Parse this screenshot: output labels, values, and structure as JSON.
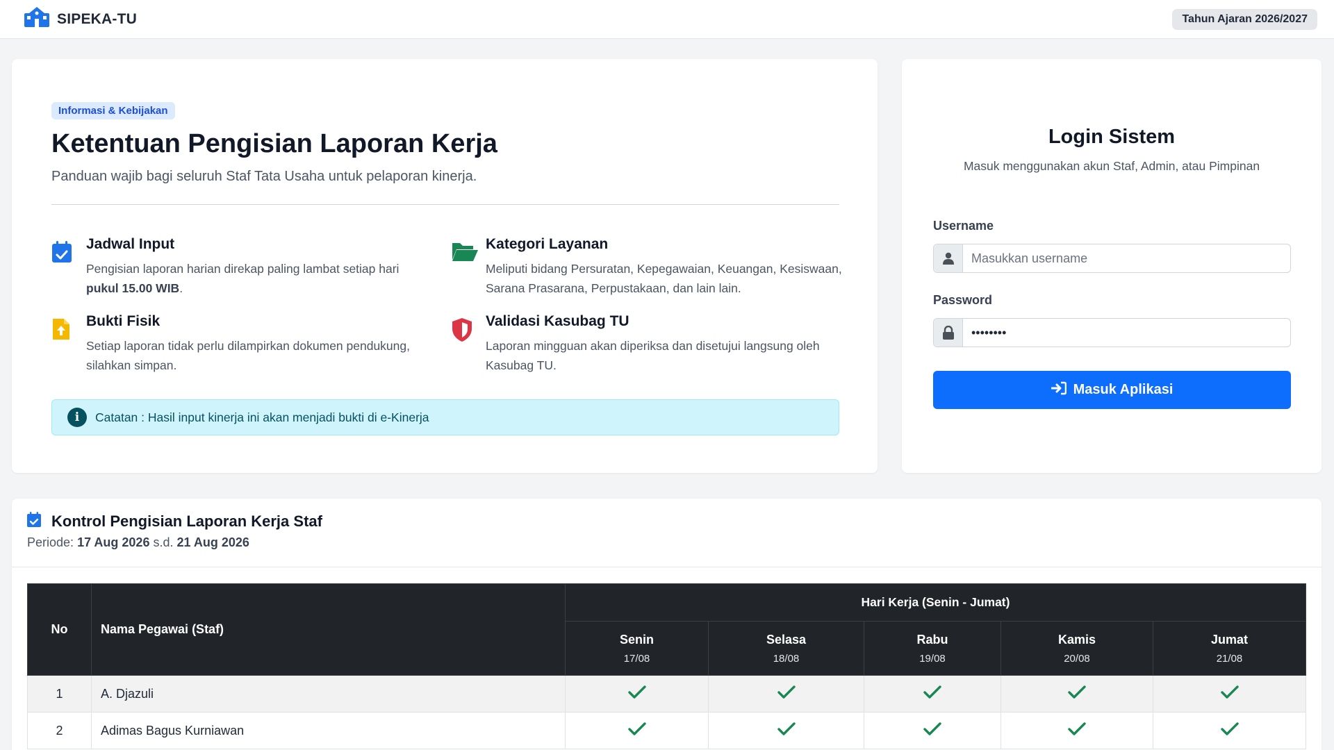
{
  "navbar": {
    "brand": "SIPEKA-TU",
    "year_badge": "Tahun Ajaran 2026/2027"
  },
  "info": {
    "pill": "Informasi & Kebijakan",
    "title": "Ketentuan Pengisian Laporan Kerja",
    "subtitle": "Panduan wajib bagi seluruh Staf Tata Usaha untuk pelaporan kinerja.",
    "features": [
      {
        "title": "Jadwal Input",
        "text": "Pengisian laporan harian direkap paling lambat setiap hari",
        "bold": "pukul 15.00 WIB",
        "suffix": ".",
        "icon": "calendar-check-icon"
      },
      {
        "title": "Kategori Layanan",
        "text": "Meliputi bidang Persuratan, Kepegawaian, Keuangan, Kesiswaan, Sarana Prasarana, Perpustakaan, dan lain lain.",
        "icon": "folder-open-icon"
      },
      {
        "title": "Bukti Fisik",
        "text": "Setiap laporan tidak perlu dilampirkan dokumen pendukung, silahkan simpan.",
        "icon": "file-upload-icon"
      },
      {
        "title": "Validasi Kasubag TU",
        "text": "Laporan mingguan akan diperiksa dan disetujui langsung oleh Kasubag TU.",
        "icon": "shield-icon"
      }
    ],
    "note": "Catatan : Hasil input kinerja ini akan menjadi bukti di e-Kinerja"
  },
  "login": {
    "title": "Login Sistem",
    "subtitle": "Masuk menggunakan akun Staf, Admin, atau Pimpinan",
    "username_label": "Username",
    "username_placeholder": "Masukkan username",
    "username_value": "",
    "password_label": "Password",
    "password_value": "••••••••",
    "submit_label": "Masuk Aplikasi"
  },
  "report": {
    "title": "Kontrol Pengisian Laporan Kerja Staf",
    "period_prefix": "Periode:",
    "period_start": "17 Aug 2026",
    "period_sep": "s.d.",
    "period_end": "21 Aug 2026",
    "columns": {
      "no": "No",
      "name": "Nama Pegawai (Staf)",
      "group": "Hari Kerja (Senin - Jumat)",
      "days": [
        {
          "name": "Senin",
          "date": "17/08"
        },
        {
          "name": "Selasa",
          "date": "18/08"
        },
        {
          "name": "Rabu",
          "date": "19/08"
        },
        {
          "name": "Kamis",
          "date": "20/08"
        },
        {
          "name": "Jumat",
          "date": "21/08"
        }
      ]
    },
    "rows": [
      {
        "no": "1",
        "name": "A. Djazuli",
        "status": [
          "done",
          "done",
          "done",
          "done",
          "done"
        ]
      },
      {
        "no": "2",
        "name": "Adimas Bagus Kurniawan",
        "status": [
          "done",
          "done",
          "done",
          "done",
          "done"
        ]
      }
    ]
  },
  "colors": {
    "primary": "#0d6efd",
    "brand_blue": "#1e74e8",
    "check_green": "#198754",
    "header_dark": "#212529",
    "info_bg": "#cff4fc",
    "shield_red": "#dc3545",
    "folder_green": "#198754",
    "file_yellow": "#f5b800"
  }
}
